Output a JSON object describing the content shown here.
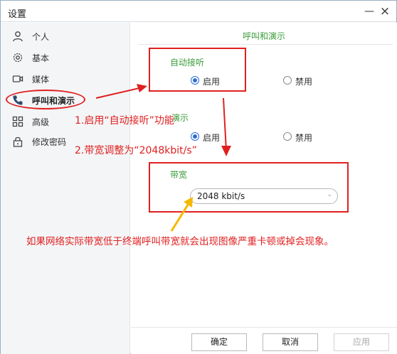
{
  "window": {
    "title": "设置",
    "minimize_glyph": "—",
    "close_glyph": "×"
  },
  "sidebar": {
    "items": [
      {
        "label": "个人",
        "icon": "person-icon"
      },
      {
        "label": "基本",
        "icon": "gear-icon"
      },
      {
        "label": "媒体",
        "icon": "camera-icon"
      },
      {
        "label": "呼叫和演示",
        "icon": "phone-icon",
        "active": true
      },
      {
        "label": "高级",
        "icon": "grid-icon"
      },
      {
        "label": "修改密码",
        "icon": "lock-icon"
      }
    ]
  },
  "main": {
    "title": "呼叫和演示",
    "auto_answer": {
      "label": "自动接听",
      "enable": "启用",
      "disable": "禁用",
      "selected": "启用"
    },
    "demo": {
      "label_visible_fragment": "演示",
      "enable": "启用",
      "disable": "禁用",
      "selected": "启用"
    },
    "bandwidth": {
      "label": "带宽",
      "value": "2048 kbit/s"
    }
  },
  "footer": {
    "ok": "确定",
    "cancel": "取消",
    "apply": "应用"
  },
  "annotations": {
    "step1": "1.启用“自动接听”功能",
    "step2": "2.带宽调整为“2048kbit/s”",
    "warning": "如果网络实际带宽低于终端呼叫带宽就会出现图像严重卡顿或掉会现象。",
    "color": "#e02020",
    "arrow_color_bandwidth": "#f5b800"
  },
  "colors": {
    "accent_green": "#3a9d3a",
    "radio_blue": "#2c6ed5",
    "annotation_red": "#e02020"
  }
}
